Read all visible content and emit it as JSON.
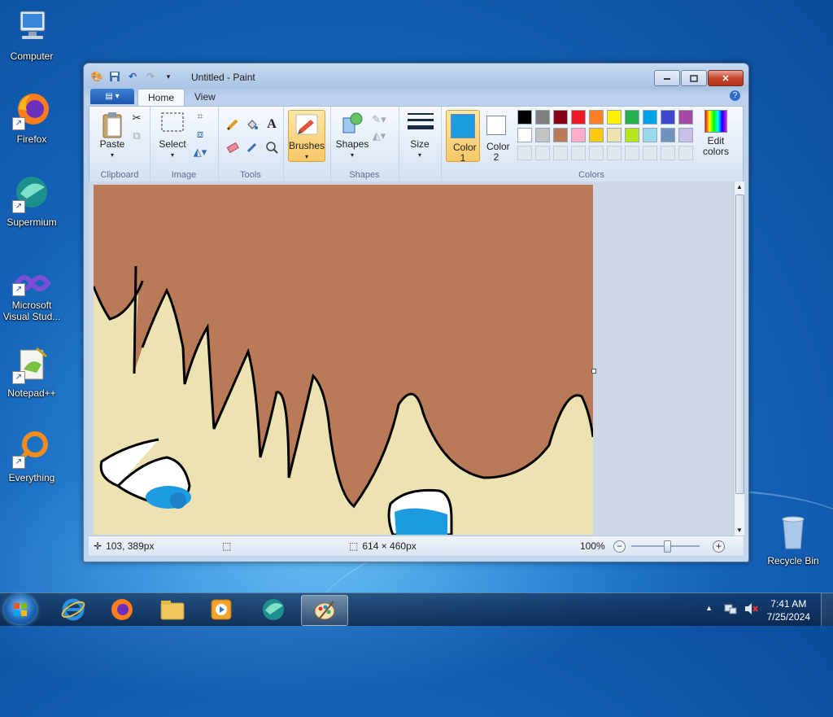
{
  "desktop": {
    "icons": [
      {
        "label": "Computer"
      },
      {
        "label": "Firefox"
      },
      {
        "label": "Supermium"
      },
      {
        "label": "Microsoft Visual Stud..."
      },
      {
        "label": "Notepad++"
      },
      {
        "label": "Everything"
      },
      {
        "label": "Recycle Bin"
      }
    ]
  },
  "window": {
    "title": "Untitled - Paint",
    "tabs": [
      {
        "label": "Home"
      },
      {
        "label": "View"
      }
    ],
    "ribbon": {
      "clipboard": {
        "label": "Clipboard",
        "paste_label": "Paste"
      },
      "image": {
        "label": "Image",
        "select_label": "Select"
      },
      "tools": {
        "label": "Tools"
      },
      "brushes_label": "Brushes",
      "shapes": {
        "label": "Shapes",
        "shapes_label": "Shapes"
      },
      "size_label": "Size",
      "colors": {
        "label": "Colors",
        "color1_label": "Color 1",
        "color2_label": "Color 2",
        "edit_colors_label": "Edit colors",
        "color1": "#1d9be0",
        "color2": "#ffffff",
        "palette_row1": [
          "#000000",
          "#7f7f7f",
          "#880015",
          "#ed1c24",
          "#ff7f27",
          "#fff200",
          "#22b14c",
          "#00a2e8",
          "#3f48cc",
          "#a349a4"
        ],
        "palette_row2": [
          "#ffffff",
          "#c3c3c3",
          "#b97a57",
          "#ffaec9",
          "#ffc90e",
          "#efe4b0",
          "#b5e61d",
          "#99d9ea",
          "#7092be",
          "#c8bfe7"
        ]
      }
    },
    "status": {
      "cursor_pos": "103, 389px",
      "canvas_size": "614 × 460px",
      "zoom": "100%"
    }
  },
  "taskbar": {
    "time": "7:41 AM",
    "date": "7/25/2024"
  }
}
